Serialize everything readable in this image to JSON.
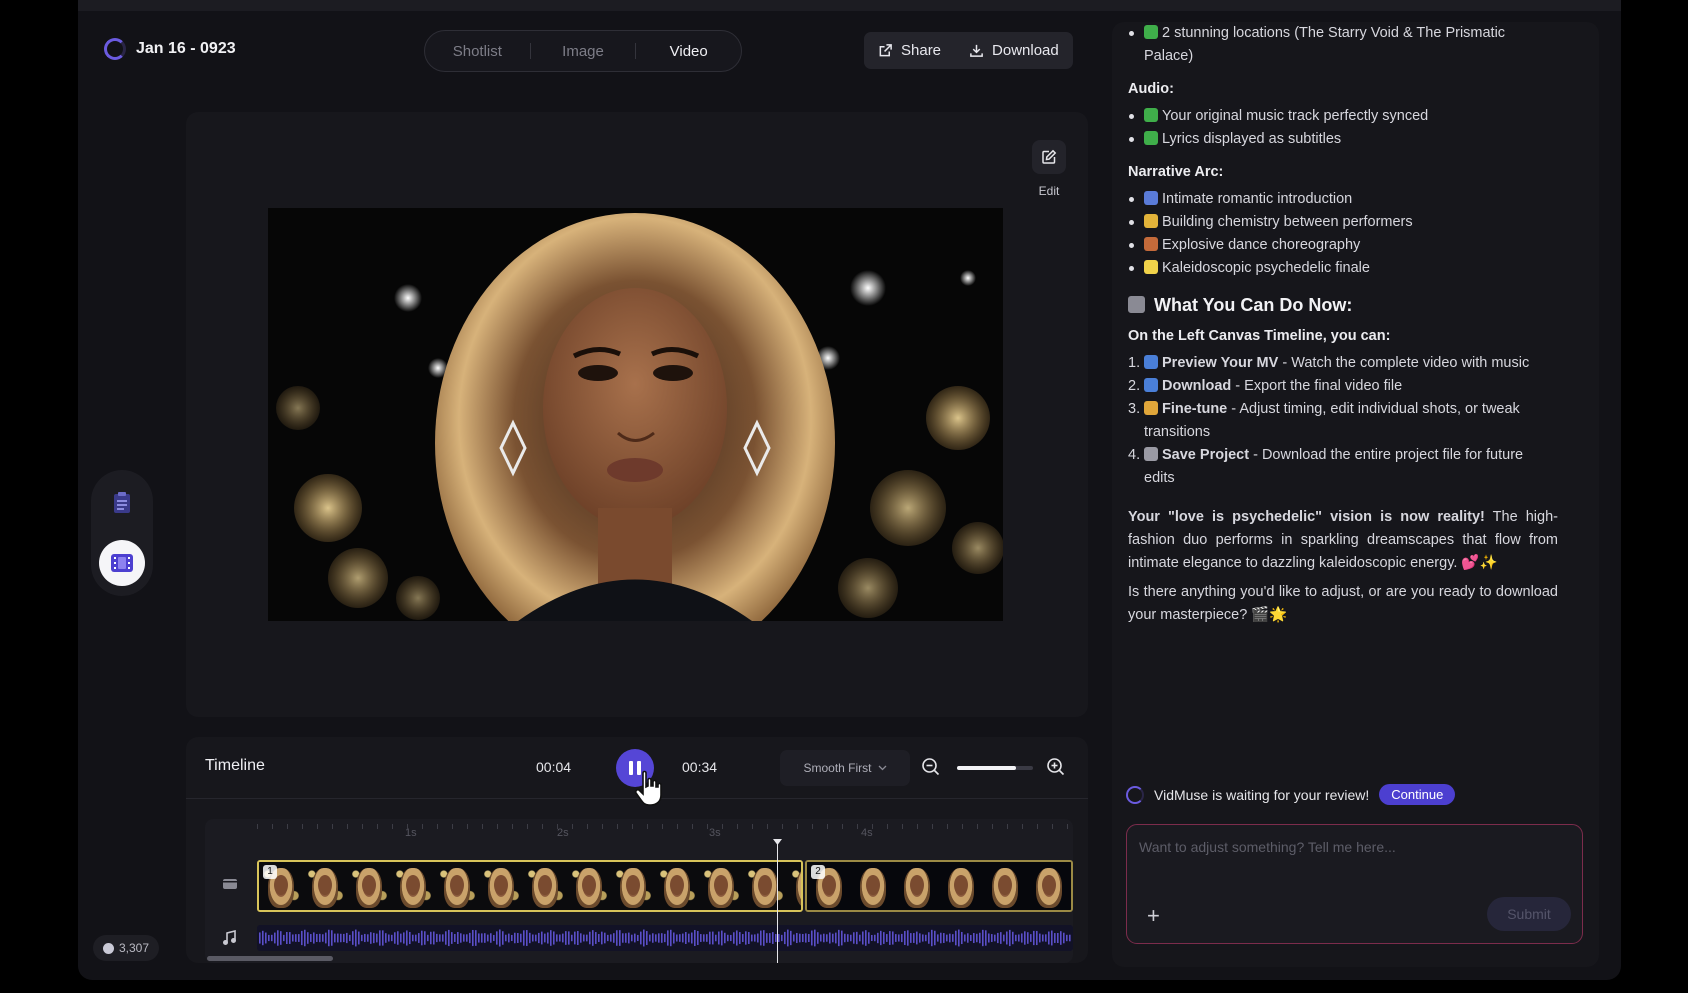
{
  "header": {
    "project_title": "Jan 16 - 0923",
    "tabs": [
      {
        "label": "Shotlist"
      },
      {
        "label": "Image"
      },
      {
        "label": "Video"
      }
    ],
    "share_label": "Share",
    "download_label": "Download"
  },
  "canvas": {
    "edit_label": "Edit"
  },
  "timeline": {
    "title": "Timeline",
    "current_time": "00:04",
    "total_time": "00:34",
    "mode": "Smooth First",
    "zoom_level": 0.78,
    "ruler_labels": [
      "1s",
      "2s",
      "3s",
      "4s"
    ],
    "clip_1_number": "1",
    "clip_2_number": "2"
  },
  "credits": {
    "value": "3,307"
  },
  "chat": {
    "top_bullet": "2 stunning locations (The Starry Void & The Prismatic Palace)",
    "audio_heading": "Audio:",
    "audio_items": [
      "Your original music track perfectly synced",
      "Lyrics displayed as subtitles"
    ],
    "narrative_heading": "Narrative Arc:",
    "narrative_items": [
      "Intimate romantic introduction",
      "Building chemistry between performers",
      "Explosive dance choreography",
      "Kaleidoscopic psychedelic finale"
    ],
    "what_heading": "What You Can Do Now:",
    "canvas_heading": "On the Left Canvas Timeline, you can:",
    "steps": [
      {
        "n": "1.",
        "title": "Preview Your MV",
        "desc": " - Watch the complete video with music"
      },
      {
        "n": "2.",
        "title": "Download",
        "desc": " - Export the final video file"
      },
      {
        "n": "3.",
        "title": "Fine-tune",
        "desc": " - Adjust timing, edit individual shots, or tweak transitions"
      },
      {
        "n": "4.",
        "title": "Save Project",
        "desc": " - Download the entire project file for future edits"
      }
    ],
    "para1_bold": "Your \"love is psychedelic\" vision is now reality!",
    "para1_rest": " The high-fashion duo performs in sparkling dreamscapes that flow from intimate elegance to dazzling kaleidoscopic energy. 💕✨",
    "para2": "Is there anything you'd like to adjust, or are you ready to download your masterpiece? 🎬🌟",
    "status_text": "VidMuse is waiting for your review!",
    "continue_label": "Continue",
    "input_placeholder": "Want to adjust something? Tell me here...",
    "submit_label": "Submit"
  }
}
